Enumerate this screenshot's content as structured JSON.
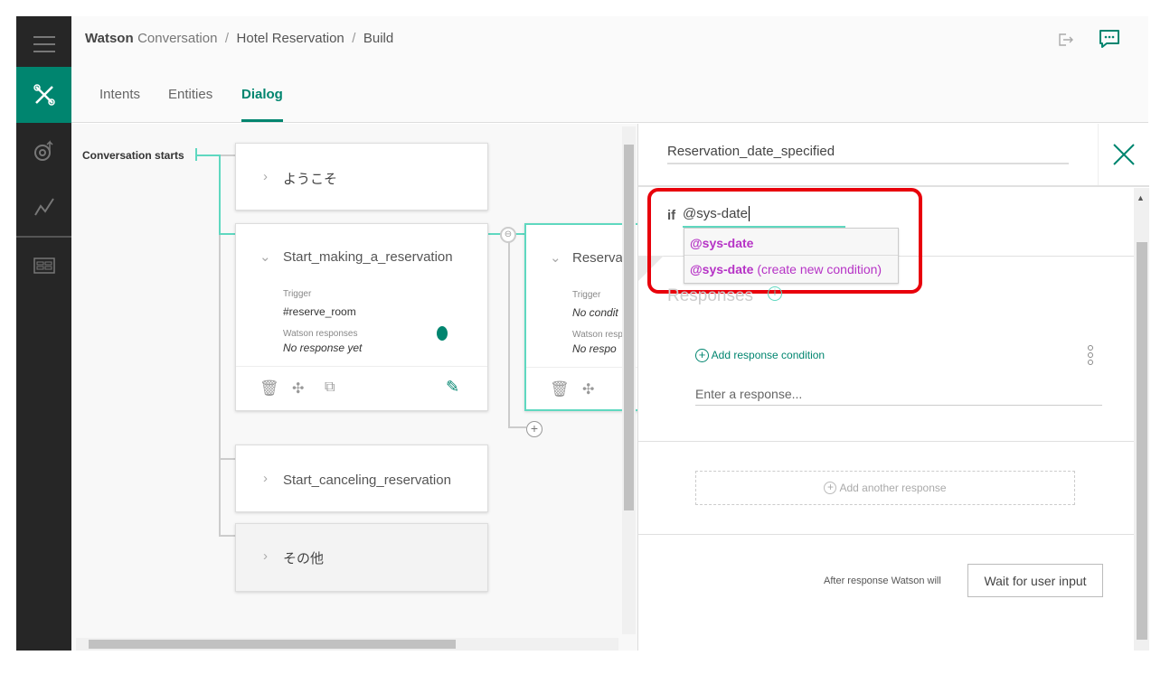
{
  "header": {
    "breadcrumb": {
      "brand_bold": "Watson",
      "brand_rest": "Conversation",
      "project": "Hotel Reservation",
      "page": "Build",
      "separator": "/"
    },
    "tabs": [
      {
        "label": "Intents"
      },
      {
        "label": "Entities"
      },
      {
        "label": "Dialog",
        "active": true
      }
    ]
  },
  "sidebar": {
    "items": [
      "menu-icon",
      "build-icon",
      "improve-icon",
      "analytics-icon",
      "deploy-icon"
    ]
  },
  "canvas": {
    "start_label": "Conversation starts",
    "nodes": [
      {
        "title": "ようこそ",
        "collapsed": true
      },
      {
        "title": "Start_making_a_reservation",
        "trigger_label": "Trigger",
        "trigger": "#reserve_room",
        "responses_label": "Watson responses",
        "responses": "No response yet"
      },
      {
        "title": "Reservation_date_specified",
        "visible_title": "Reserva",
        "trigger_label": "Trigger",
        "trigger": "No condit",
        "responses_label": "Watson resp",
        "responses": "No respo"
      },
      {
        "title": "Start_canceling_reservation",
        "collapsed": true
      },
      {
        "title": "その他",
        "collapsed": true
      }
    ]
  },
  "panel": {
    "node_name": "Reservation_date_specified",
    "if_label": "if",
    "condition_value": "@sys-date",
    "suggestions": [
      {
        "entity": "@sys-date",
        "note": ""
      },
      {
        "entity": "@sys-date",
        "note": "(create new condition)"
      }
    ],
    "responses_heading": "Responses",
    "add_response_condition": "Add response condition",
    "response_placeholder": "Enter a response...",
    "add_another_response": "Add another response",
    "after_response_label": "After response Watson will",
    "after_response_button": "Wait for user input"
  },
  "colors": {
    "accent": "#00856f",
    "teal_line": "#5fd8c0",
    "sidebar": "#262626",
    "suggestion": "#b633c6",
    "highlight_box": "#e8000b"
  }
}
